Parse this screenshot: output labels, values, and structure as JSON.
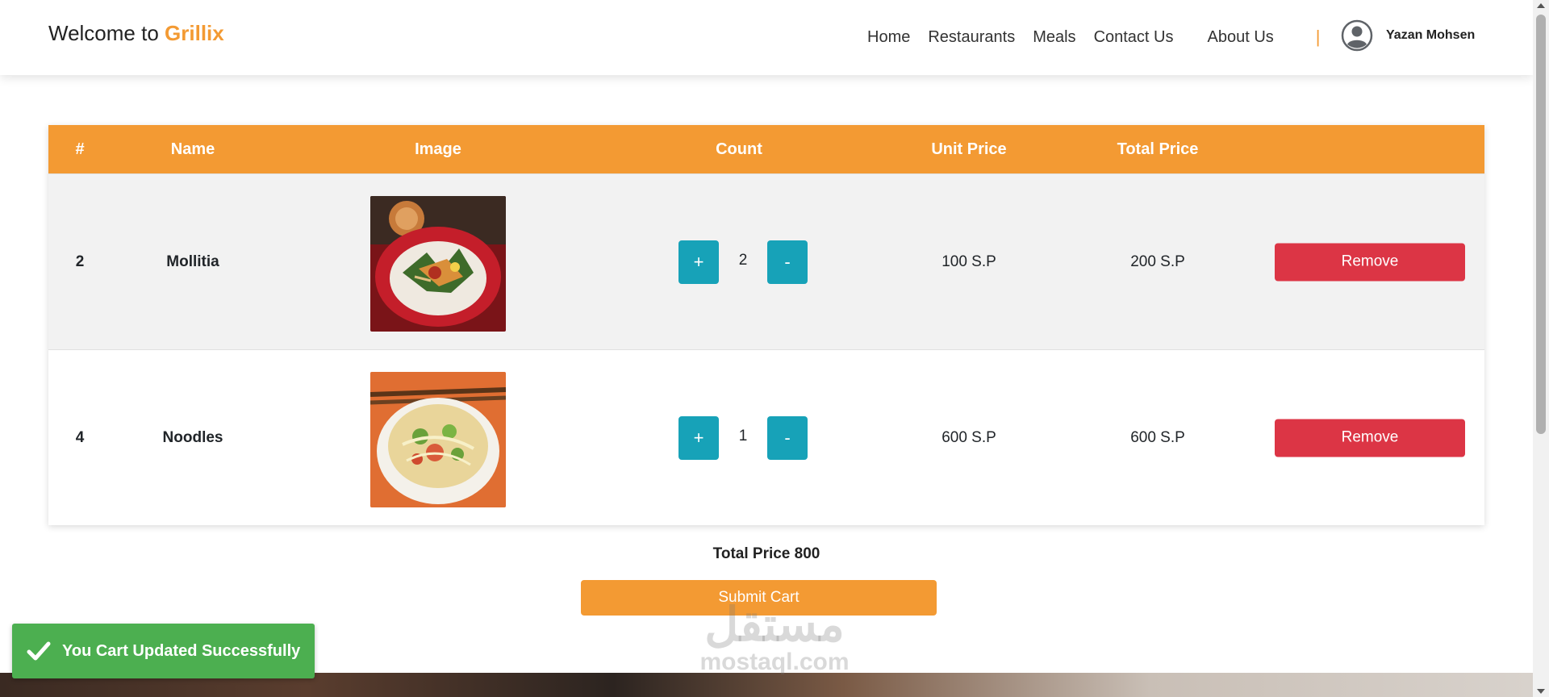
{
  "header": {
    "brand_prefix": "Welcome to",
    "brand_name": "Grillix",
    "nav": [
      "Home",
      "Restaurants",
      "Meals",
      "Contact Us",
      "About Us"
    ],
    "separator": "|",
    "user_name": "Yazan Mohsen"
  },
  "table": {
    "columns": [
      "#",
      "Name",
      "Image",
      "Count",
      "Unit Price",
      "Total Price"
    ],
    "rows": [
      {
        "id": "2",
        "name": "Mollitia",
        "count": "2",
        "unit_price": "100 S.P",
        "total_price": "200 S.P",
        "remove": "Remove",
        "plus": "+",
        "minus": "-"
      },
      {
        "id": "4",
        "name": "Noodles",
        "count": "1",
        "unit_price": "600 S.P",
        "total_price": "600 S.P",
        "remove": "Remove",
        "plus": "+",
        "minus": "-"
      }
    ]
  },
  "summary": {
    "total_line": "Total Price 800",
    "submit_label": "Submit Cart"
  },
  "toast": {
    "message": "You Cart Updated Successfully"
  },
  "watermark": {
    "arabic": "مستقل",
    "latin": "mostaql.com"
  },
  "colors": {
    "accent": "#f39a33",
    "counter": "#17a2b8",
    "remove": "#dc3545",
    "toast": "#4caf50"
  }
}
